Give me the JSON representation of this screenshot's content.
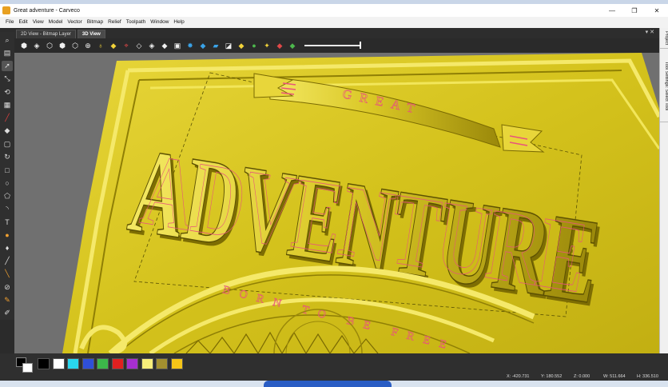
{
  "window": {
    "title": "Great adventure - Carveco",
    "min_label": "—",
    "max_label": "❐",
    "close_label": "✕"
  },
  "menu": [
    "File",
    "Edit",
    "View",
    "Model",
    "Vector",
    "Bitmap",
    "Relief",
    "Toolpath",
    "Window",
    "Help"
  ],
  "tabs": [
    {
      "label": "2D View - Bitmap Layer",
      "active": false
    },
    {
      "label": "3D View",
      "active": true
    }
  ],
  "tab_controls": "▾ ✕",
  "right_tabs": [
    "Project",
    "Tool Settings: Select Tool"
  ],
  "artwork": {
    "top_text": "GREAT",
    "main_text": "ADVENTURE",
    "sub_text": "BORN TO BE FREE"
  },
  "palette": [
    "#000000",
    "#ffffff",
    "#29d7ee",
    "#2f4fd8",
    "#3cb84a",
    "#e02020",
    "#a62fd0",
    "#f7ee7a",
    "#a3902f",
    "#f5c518"
  ],
  "status": {
    "x": "X: -420.731",
    "y": "Y: 180.552",
    "z": "Z: 0.000",
    "w": "W: 511.664",
    "h": "H: 336.510"
  },
  "colors": {
    "relief": "#d4c21c",
    "relief_dark": "#8f7f05",
    "relief_light": "#f2e65a",
    "vector": "#e8557a",
    "viewport_bg": "#6e6e6e"
  }
}
